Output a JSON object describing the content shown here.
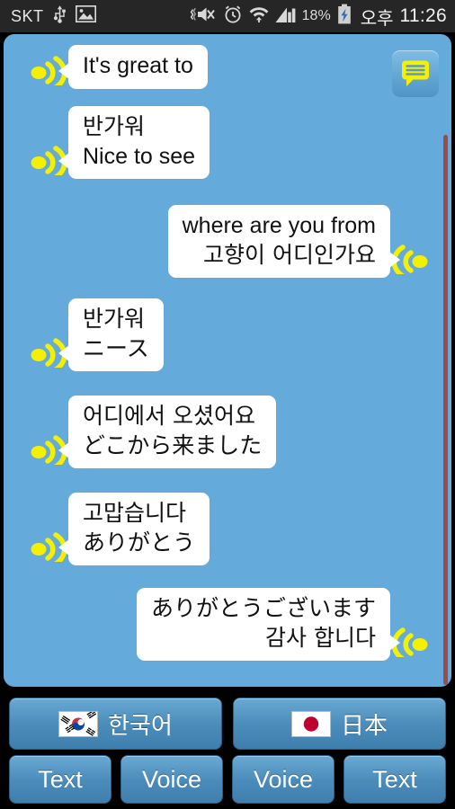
{
  "status_bar": {
    "carrier": "SKT",
    "icons": [
      "usb-icon",
      "screenshot-image-icon",
      "mute-vibrate-icon",
      "alarm-clock-icon",
      "wifi-icon",
      "cellular-signal-icon",
      "battery-charging-icon"
    ],
    "battery_percent": "18%",
    "am_pm": "오후",
    "time": "11:26"
  },
  "chat": {
    "corner_icon": "speech-bubble-icon",
    "scrollbar": {
      "name": "vertical-scrollbar"
    },
    "messages": [
      {
        "side": "left",
        "speaker_icon": "speaker-wave-right-icon",
        "lines": [
          "It's great to"
        ],
        "scripts": [
          "en"
        ]
      },
      {
        "side": "left",
        "speaker_icon": "speaker-wave-right-icon",
        "lines": [
          "반가워",
          "Nice to see"
        ],
        "scripts": [
          "cjk",
          "en"
        ]
      },
      {
        "side": "right",
        "speaker_icon": "speaker-wave-left-icon",
        "lines": [
          "where are you from",
          "고향이 어디인가요"
        ],
        "scripts": [
          "en",
          "cjk"
        ]
      },
      {
        "side": "left",
        "speaker_icon": "speaker-wave-right-icon",
        "lines": [
          "반가워",
          "ニース"
        ],
        "scripts": [
          "cjk",
          "cjk"
        ]
      },
      {
        "side": "left",
        "speaker_icon": "speaker-wave-right-icon",
        "lines": [
          "어디에서 오셨어요",
          "どこから来ました"
        ],
        "scripts": [
          "cjk",
          "cjk"
        ]
      },
      {
        "side": "left",
        "speaker_icon": "speaker-wave-right-icon",
        "lines": [
          "고맙습니다",
          "ありがとう"
        ],
        "scripts": [
          "cjk",
          "cjk"
        ]
      },
      {
        "side": "right",
        "speaker_icon": "speaker-wave-left-icon",
        "lines": [
          "ありがとうございます",
          "감사 합니다"
        ],
        "scripts": [
          "cjk",
          "cjk"
        ]
      }
    ]
  },
  "language_row": {
    "buttons": [
      {
        "flag": "south-korea-flag",
        "label": "한국어"
      },
      {
        "flag": "japan-flag",
        "label": "日本"
      }
    ]
  },
  "mode_row": {
    "buttons": [
      {
        "label": "Text"
      },
      {
        "label": "Voice"
      },
      {
        "label": "Voice"
      },
      {
        "label": "Text"
      }
    ]
  },
  "colors": {
    "chat_background": "#64abdc",
    "bubble": "#ffffff",
    "speaker_icon": "#f5f000",
    "button_top": "#6aa9d2",
    "button_bottom": "#3f7fae",
    "status_bar": "#262626",
    "scrollbar_thumb": "#9c4a4a"
  }
}
